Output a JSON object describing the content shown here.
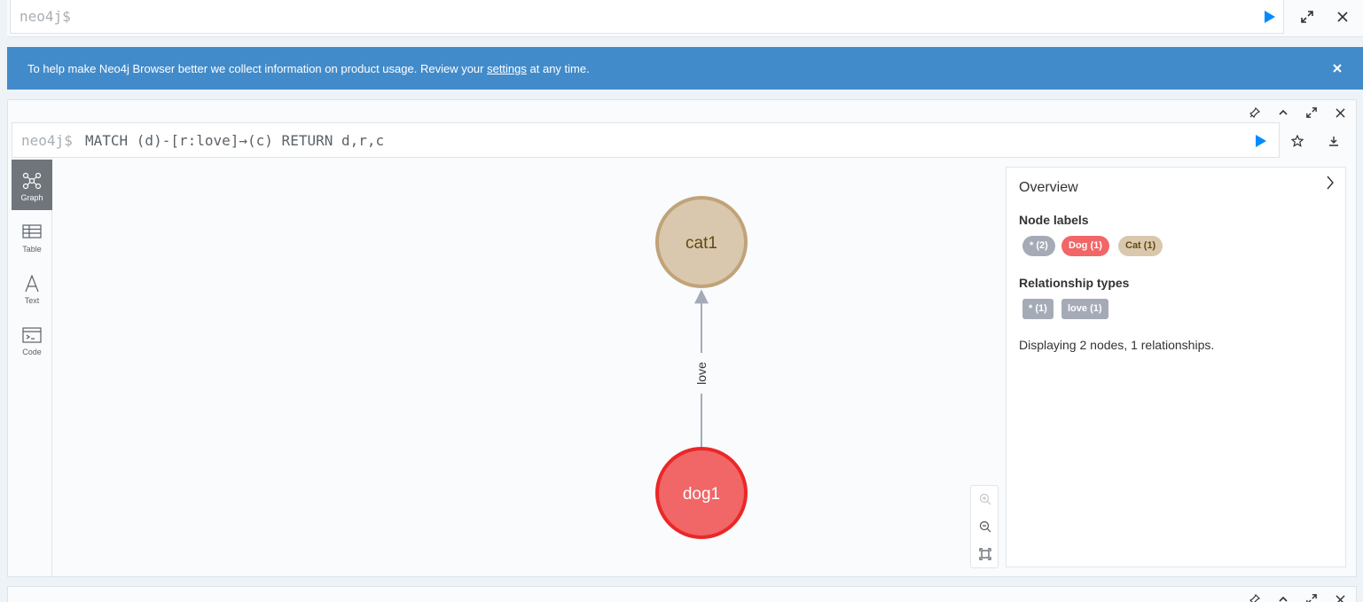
{
  "top_editor": {
    "prompt": "neo4j$"
  },
  "banner": {
    "text_before": "To help make Neo4j Browser better we collect information on product usage. Review your ",
    "link": "settings",
    "text_after": " at any time."
  },
  "frame": {
    "prompt": "neo4j$",
    "query": "MATCH (d)-[r:love]→(c) RETURN d,r,c"
  },
  "sidebar": {
    "items": [
      {
        "label": "Graph",
        "icon": "graph-icon",
        "active": true
      },
      {
        "label": "Table",
        "icon": "table-icon"
      },
      {
        "label": "Text",
        "icon": "text-icon"
      },
      {
        "label": "Code",
        "icon": "code-icon"
      }
    ]
  },
  "graph": {
    "nodes": [
      {
        "id": "cat1",
        "label": "cat1",
        "type": "Cat"
      },
      {
        "id": "dog1",
        "label": "dog1",
        "type": "Dog"
      }
    ],
    "relationships": [
      {
        "type": "love",
        "from": "dog1",
        "to": "cat1"
      }
    ]
  },
  "overview": {
    "title": "Overview",
    "node_labels_heading": "Node labels",
    "node_labels": [
      {
        "text": "* (2)",
        "bg": "#a5abb6",
        "fg": "#ffffff"
      },
      {
        "text": "Dog (1)",
        "bg": "#f16667",
        "fg": "#ffffff"
      },
      {
        "text": "Cat (1)",
        "bg": "#d9c8ae",
        "fg": "#604a0e"
      }
    ],
    "rel_types_heading": "Relationship types",
    "rel_types": [
      {
        "text": "* (1)"
      },
      {
        "text": "love (1)"
      }
    ],
    "summary": "Displaying 2 nodes, 1 relationships."
  },
  "colors": {
    "cat_fill": "#d9c8ae",
    "cat_stroke": "#c0a378",
    "dog_fill": "#f16667",
    "dog_stroke": "#eb2728",
    "accent": "#018bff",
    "banner": "#428bca"
  }
}
